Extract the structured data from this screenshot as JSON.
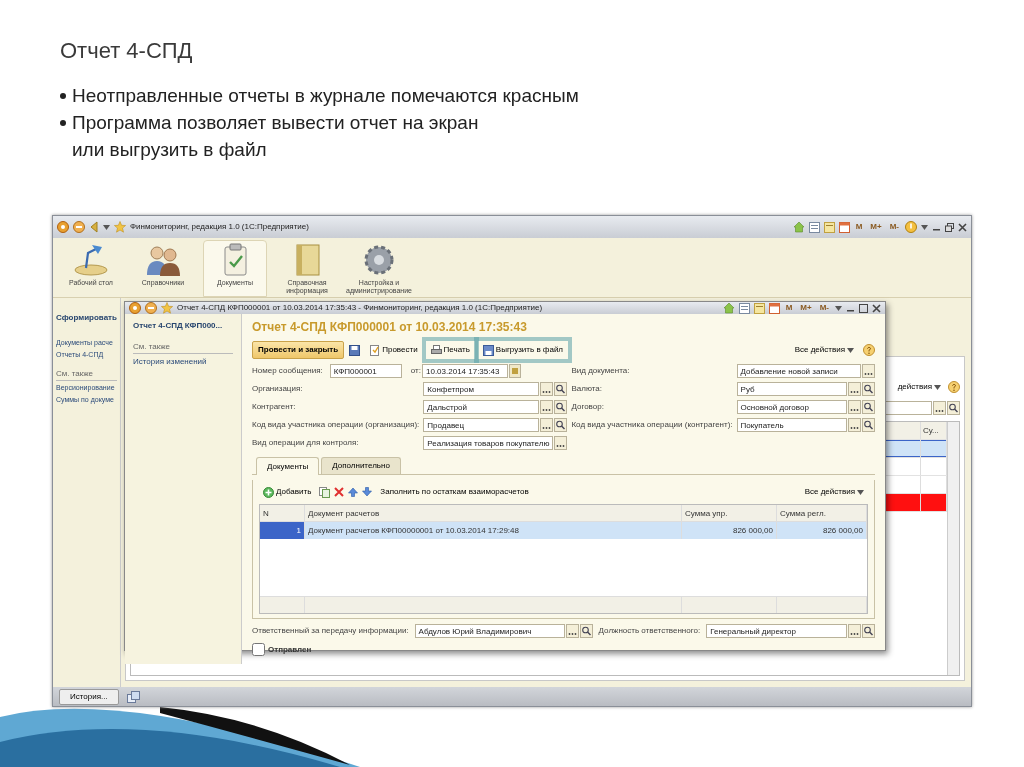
{
  "slide": {
    "title": "Отчет 4-СПД",
    "bullets": [
      {
        "lines": [
          "Неотправленные отчеты в журнале помечаются красным"
        ]
      },
      {
        "lines": [
          "Программа позволяет вывести отчет на экран",
          "или выгрузить в файл"
        ]
      }
    ]
  },
  "main_window": {
    "title": "Финмониторинг, редакция 1.0  (1С:Предприятие)",
    "memory_buttons": [
      "M",
      "M+",
      "M-"
    ],
    "sections": [
      {
        "label": "Рабочий стол",
        "selected": false
      },
      {
        "label": "Справочники",
        "selected": false
      },
      {
        "label": "Документы",
        "selected": true
      },
      {
        "label": "Справочная информация",
        "selected": false
      },
      {
        "label": "Настройка и администрирование",
        "selected": false
      }
    ],
    "sidebar": {
      "command": "Сформировать",
      "items": [
        "Документы расче",
        "Отчеты 4-СПД"
      ],
      "see_also": "См. также",
      "see_also_items": [
        "Версионирование",
        "Суммы по докуме"
      ]
    },
    "list": {
      "actions": "действия",
      "column": "Су...",
      "rows": [
        {
          "selected": true,
          "sent": true
        },
        {
          "selected": false,
          "sent": true
        },
        {
          "selected": false,
          "sent": true
        },
        {
          "selected": false,
          "sent": false
        }
      ]
    },
    "status_bar": {
      "history_button": "История..."
    }
  },
  "dialog": {
    "title": "Отчет 4-СПД КФП000001 от 10.03.2014 17:35:43 - Финмониторинг, редакция 1.0  (1С:Предприятие)",
    "memory_buttons": [
      "M",
      "M+",
      "M-"
    ],
    "nav": {
      "current": "Отчет 4-СПД КФП000...",
      "see_also": "См. также",
      "items": [
        "История изменений"
      ]
    },
    "heading": "Отчет 4-СПД КФП000001 от 10.03.2014 17:35:43",
    "commands": [
      {
        "kind": "default",
        "label": "Провести и закрыть",
        "highlighted": false
      },
      {
        "kind": "save",
        "highlighted": false
      },
      {
        "kind": "post",
        "label": "Провести",
        "highlighted": false
      },
      {
        "kind": "print",
        "label": "Печать",
        "highlighted": true
      },
      {
        "kind": "export",
        "label": "Выгрузить в файл",
        "highlighted": true
      }
    ],
    "all_actions": "Все действия",
    "number": {
      "label": "Номер сообщения:",
      "value": "КФП000001",
      "date_label": "от:",
      "date": "10.03.2014 17:35:43"
    },
    "left_fields": [
      {
        "label": "Организация:",
        "value": "Конфетпром",
        "search": true
      },
      {
        "label": "Контрагент:",
        "value": "Дальстрой",
        "search": true
      },
      {
        "label": "Код вида участника операции (организация):",
        "value": "Продавец",
        "search": true
      },
      {
        "label": "Вид операции для контроля:",
        "value": "Реализация товаров покупателю",
        "search": false
      }
    ],
    "right_fields": [
      {
        "label": "Вид документа:",
        "value": "Добавление новой записи",
        "search": false
      },
      {
        "label": "Валюта:",
        "value": "Руб",
        "search": true
      },
      {
        "label": "Договор:",
        "value": "Основной договор",
        "search": true
      },
      {
        "label": "Код вида участника операции (контрагент):",
        "value": "Покупатель",
        "search": true
      }
    ],
    "tabs": [
      {
        "label": "Документы",
        "selected": true
      },
      {
        "label": "Дополнительно",
        "selected": false
      }
    ],
    "table_toolbar": {
      "add": "Добавить",
      "fill": "Заполнить по остаткам взаиморасчетов",
      "all_actions": "Все действия"
    },
    "table": {
      "columns": [
        "N",
        "Документ расчетов",
        "Сумма упр.",
        "Сумма регл."
      ],
      "rows": [
        {
          "cells": [
            "1",
            "Документ расчетов КФП00000001 от 10.03.2014 17:29:48",
            "826 000,00",
            "826 000,00"
          ],
          "selected": true
        }
      ]
    },
    "responsible": {
      "label": "Ответственный за передачу информации:",
      "value": "Абдулов Юрий Владимирович",
      "search": true
    },
    "position": {
      "label": "Должность ответственного:",
      "value": "Генеральный директор",
      "search": true
    },
    "sent": {
      "label": "Отправлен",
      "checked": false
    }
  }
}
